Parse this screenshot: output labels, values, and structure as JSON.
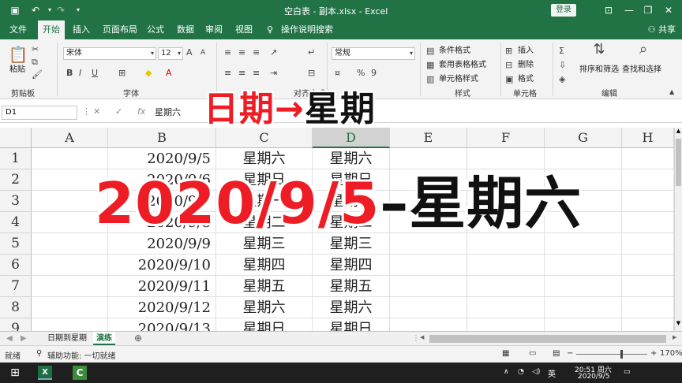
{
  "titlebar": {
    "save_icon": "save-icon",
    "undo_icon": "undo-icon",
    "redo_icon": "redo-icon",
    "customize_icon": "dropdown-icon",
    "title": "空白表 - 副本.xlsx  -  Excel",
    "login_label": "登录"
  },
  "tabs": {
    "items": [
      "文件",
      "开始",
      "插入",
      "页面布局",
      "公式",
      "数据",
      "审阅",
      "视图"
    ],
    "active": "开始",
    "tell_me": "操作说明搜索",
    "share": "共享"
  },
  "ribbon": {
    "clipboard": {
      "paste_label": "粘贴",
      "group_label": "剪贴板"
    },
    "font": {
      "font_name": "宋体",
      "font_size": "12",
      "bold": "B",
      "italic": "I",
      "underline": "U",
      "group_label": "字体"
    },
    "alignment": {
      "group_label": "对齐方式"
    },
    "number": {
      "format": "常规",
      "percent": "%",
      "comma": "9"
    },
    "styles": {
      "conditional": "条件格式",
      "table_format": "套用表格格式",
      "cell_styles": "单元格样式",
      "group_label": "样式"
    },
    "cells": {
      "insert": "插入",
      "delete": "删除",
      "format": "格式",
      "group_label": "单元格"
    },
    "editing": {
      "sort_filter": "排序和筛选",
      "find_select": "查找和选择",
      "group_label": "编辑"
    }
  },
  "formula_bar": {
    "name_box": "D1",
    "cancel": "✕",
    "confirm": "✓",
    "fx": "fx",
    "content": "星期六"
  },
  "grid": {
    "columns": [
      "A",
      "B",
      "C",
      "D",
      "E",
      "F",
      "G",
      "H"
    ],
    "rows": [
      "1",
      "2",
      "3",
      "4",
      "5",
      "6",
      "7",
      "8",
      "9"
    ],
    "data": [
      {
        "b": "2020/9/5",
        "c": "星期六",
        "d": "星期六"
      },
      {
        "b": "2020/9/6",
        "c": "星期日",
        "d": "星期日"
      },
      {
        "b": "2020/9/7",
        "c": "星期一",
        "d": "星期一"
      },
      {
        "b": "2020/9/8",
        "c": "星期二",
        "d": "星期二"
      },
      {
        "b": "2020/9/9",
        "c": "星期三",
        "d": "星期三"
      },
      {
        "b": "2020/9/10",
        "c": "星期四",
        "d": "星期四"
      },
      {
        "b": "2020/9/11",
        "c": "星期五",
        "d": "星期五"
      },
      {
        "b": "2020/9/12",
        "c": "星期六",
        "d": "星期六"
      },
      {
        "b": "2020/9/13",
        "c": "星期日",
        "d": "星期日"
      }
    ]
  },
  "sheets": {
    "tabs": [
      "日期到星期",
      "演练"
    ],
    "active": "演练",
    "add": "⊕"
  },
  "statusbar": {
    "ready": "就绪",
    "accessibility": "辅助功能: 一切就绪",
    "zoom": "170%"
  },
  "taskbar": {
    "ime": "英",
    "time": "20:51 周六",
    "date": "2020/9/5"
  },
  "overlay": {
    "line1_red": "日期→",
    "line1_black": "星期",
    "line2_red": "2020/9/5",
    "line2_black": "–星期六"
  }
}
